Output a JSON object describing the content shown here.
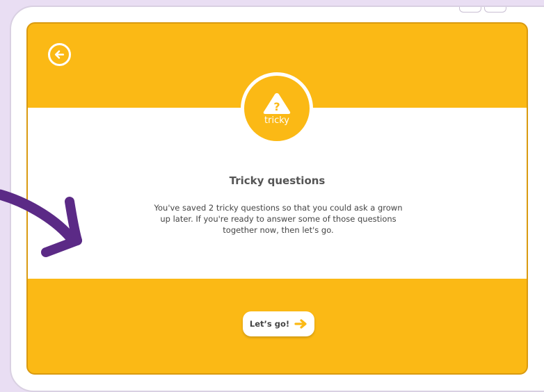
{
  "screen": {
    "back_icon": "arrow-left-circle-icon",
    "badge": {
      "icon": "warning-triangle-question-icon",
      "icon_text": "?",
      "label": "tricky"
    },
    "title": "Tricky questions",
    "message": "You've saved 2 tricky questions so that you could ask a grown up later. If you're ready to answer some of those questions together now, then let's go.",
    "go_button": {
      "label": "Let’s go!",
      "icon": "arrow-right-icon"
    }
  },
  "decoration": {
    "pointer_arrow_icon": "hand-drawn-arrow-icon"
  },
  "colors": {
    "background": "#e9def3",
    "accent": "#fbb915",
    "pointer_arrow": "#5b2a86",
    "text": "#555555"
  }
}
